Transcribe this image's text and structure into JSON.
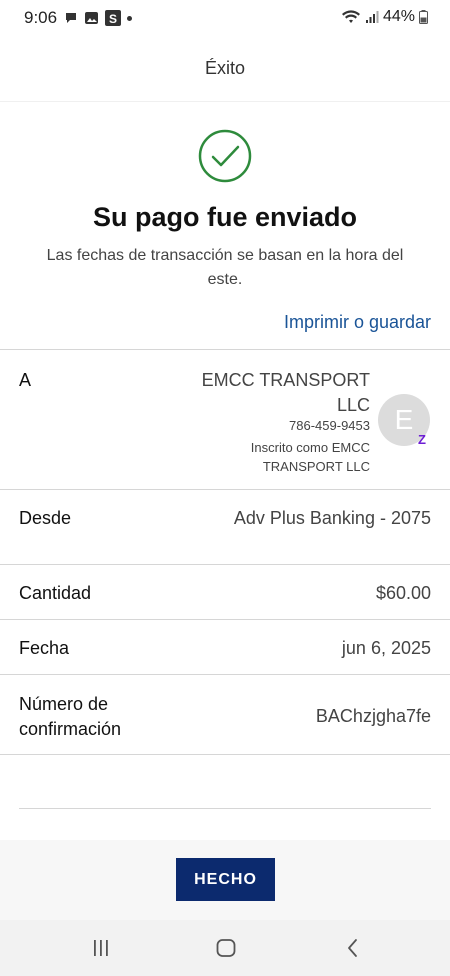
{
  "status_bar": {
    "time": "9:06",
    "battery": "44%"
  },
  "header": {
    "title": "Éxito"
  },
  "confirmation": {
    "title": "Su pago fue enviado",
    "subtitle": "Las fechas de transacción se basan en la hora del este.",
    "print_link": "Imprimir o guardar"
  },
  "details": {
    "to": {
      "label": "A",
      "name": "EMCC TRANSPORT LLC",
      "phone": "786-459-9453",
      "enrolled_as": "Inscrito como EMCC TRANSPORT LLC",
      "avatar_initial": "E",
      "badge_letter": "Z"
    },
    "from": {
      "label": "Desde",
      "value": "Adv Plus Banking - 2075"
    },
    "amount": {
      "label": "Cantidad",
      "value": "$60.00"
    },
    "date": {
      "label": "Fecha",
      "value": "jun 6, 2025"
    },
    "confirmation_number": {
      "label": "Número de confirmación",
      "value": "BAChzjgha7fe"
    }
  },
  "footer": {
    "done_button": "HECHO"
  },
  "colors": {
    "success_green": "#2e8b3c",
    "link_blue": "#1a5497",
    "button_navy": "#0c2a6e",
    "zelle_purple": "#6d1ed4"
  },
  "icons": {
    "success": "check-circle-icon",
    "nav_recent": "recent-apps-icon",
    "nav_home": "home-icon",
    "nav_back": "back-icon"
  }
}
